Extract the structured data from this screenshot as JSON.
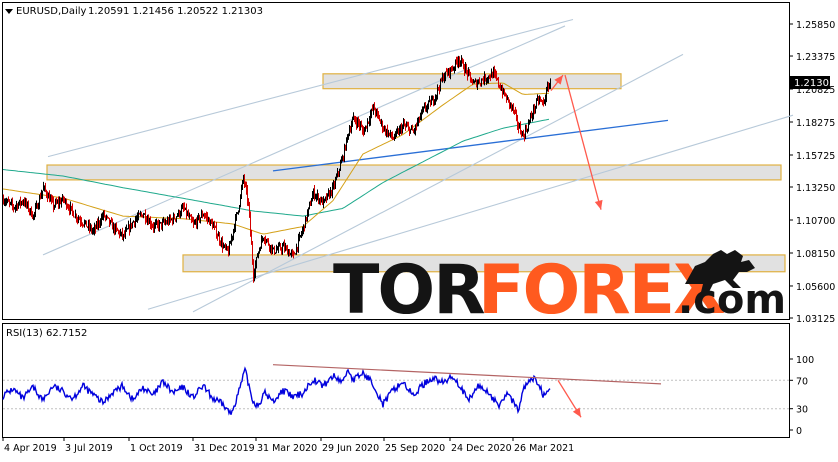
{
  "header": {
    "symbol_label": "EURUSD,Daily",
    "ohlc": "1.20591 1.21456 1.20522 1.21303"
  },
  "price_panel": {
    "current_price": "1.21303"
  },
  "rsi_panel": {
    "label": "RSI(13) 62.7152"
  },
  "watermark": {
    "part1": "TOR",
    "part2": "FOREX",
    "part3": ".com"
  },
  "colors": {
    "up_candle": "#000000",
    "down_candle": "#d40000",
    "ma_fast": "#d4a017",
    "ma_slow": "#1fa98c",
    "rsi_line": "#0000dd",
    "channel": "#b7c9d9",
    "trendline": "#2a6fd6",
    "arrow": "#ff5a4d",
    "zone_fill": "#dcdcdc",
    "zone_border": "#e0b040",
    "rsi_trendline": "#b46464",
    "watermark_dark": "#141414",
    "watermark_accent": "#ff5a1f"
  },
  "chart_data": [
    {
      "type": "candlestick",
      "series": [
        {
          "name": "EURUSD",
          "values_note": "daily OHLC"
        }
      ],
      "x": [
        "4 Apr 2019",
        "3 Jul 2019",
        "1 Oct 2019",
        "31 Dec 2019",
        "31 Mar 2020",
        "29 Jun 2020",
        "25 Sep 2020",
        "24 Dec 2020",
        "26 Mar 2021"
      ],
      "y_ticks": [
        "1.25850",
        "1.23375",
        "1.20825",
        "1.18275",
        "1.15725",
        "1.13250",
        "1.10700",
        "1.08150",
        "1.05600",
        "1.03125"
      ],
      "ylim": [
        1.03125,
        1.2585
      ],
      "close_path": [
        [
          0,
          1.123
        ],
        [
          10,
          1.117
        ],
        [
          20,
          1.122
        ],
        [
          30,
          1.11
        ],
        [
          40,
          1.132
        ],
        [
          50,
          1.118
        ],
        [
          60,
          1.123
        ],
        [
          70,
          1.112
        ],
        [
          80,
          1.105
        ],
        [
          90,
          1.098
        ],
        [
          100,
          1.111
        ],
        [
          110,
          1.101
        ],
        [
          120,
          1.094
        ],
        [
          130,
          1.106
        ],
        [
          140,
          1.112
        ],
        [
          150,
          1.102
        ],
        [
          160,
          1.104
        ],
        [
          170,
          1.108
        ],
        [
          180,
          1.116
        ],
        [
          190,
          1.103
        ],
        [
          200,
          1.112
        ],
        [
          210,
          1.102
        ],
        [
          220,
          1.086
        ],
        [
          225,
          1.082
        ],
        [
          230,
          1.1
        ],
        [
          236,
          1.12
        ],
        [
          240,
          1.14
        ],
        [
          245,
          1.119
        ],
        [
          250,
          1.065
        ],
        [
          255,
          1.083
        ],
        [
          260,
          1.095
        ],
        [
          270,
          1.083
        ],
        [
          280,
          1.086
        ],
        [
          290,
          1.079
        ],
        [
          300,
          1.101
        ],
        [
          310,
          1.128
        ],
        [
          320,
          1.12
        ],
        [
          330,
          1.132
        ],
        [
          340,
          1.157
        ],
        [
          345,
          1.175
        ],
        [
          350,
          1.185
        ],
        [
          355,
          1.182
        ],
        [
          360,
          1.175
        ],
        [
          370,
          1.194
        ],
        [
          380,
          1.178
        ],
        [
          390,
          1.17
        ],
        [
          400,
          1.18
        ],
        [
          410,
          1.175
        ],
        [
          420,
          1.192
        ],
        [
          430,
          1.2
        ],
        [
          440,
          1.218
        ],
        [
          450,
          1.225
        ],
        [
          455,
          1.232
        ],
        [
          460,
          1.226
        ],
        [
          470,
          1.212
        ],
        [
          480,
          1.216
        ],
        [
          490,
          1.22
        ],
        [
          500,
          1.205
        ],
        [
          510,
          1.192
        ],
        [
          515,
          1.179
        ],
        [
          520,
          1.172
        ],
        [
          525,
          1.181
        ],
        [
          530,
          1.192
        ],
        [
          535,
          1.2
        ],
        [
          540,
          1.197
        ],
        [
          545,
          1.211
        ],
        [
          547,
          1.213
        ]
      ],
      "ma_fast_path": [
        [
          0,
          1.131
        ],
        [
          60,
          1.124
        ],
        [
          120,
          1.11
        ],
        [
          180,
          1.108
        ],
        [
          230,
          1.104
        ],
        [
          260,
          1.096
        ],
        [
          300,
          1.102
        ],
        [
          330,
          1.122
        ],
        [
          360,
          1.158
        ],
        [
          400,
          1.173
        ],
        [
          440,
          1.196
        ],
        [
          470,
          1.212
        ],
        [
          500,
          1.213
        ],
        [
          520,
          1.204
        ],
        [
          547,
          1.205
        ]
      ],
      "ma_slow_path": [
        [
          0,
          1.146
        ],
        [
          60,
          1.141
        ],
        [
          120,
          1.132
        ],
        [
          200,
          1.121
        ],
        [
          250,
          1.114
        ],
        [
          300,
          1.11
        ],
        [
          340,
          1.116
        ],
        [
          380,
          1.136
        ],
        [
          420,
          1.152
        ],
        [
          460,
          1.168
        ],
        [
          500,
          1.178
        ],
        [
          547,
          1.185
        ]
      ],
      "zones": [
        {
          "x0": 320,
          "x1": 618,
          "y0": 1.22,
          "y1": 1.2085
        },
        {
          "x0": 44,
          "x1": 778,
          "y0": 1.1495,
          "y1": 1.138
        },
        {
          "x0": 180,
          "x1": 782,
          "y0": 1.08,
          "y1": 1.067
        }
      ],
      "trendlines": [
        {
          "role": "channel",
          "from": [
            45,
            1.156
          ],
          "to": [
            570,
            1.262
          ]
        },
        {
          "role": "channel",
          "from": [
            40,
            1.08
          ],
          "to": [
            562,
            1.257
          ]
        },
        {
          "role": "channel",
          "from": [
            190,
            1.036
          ],
          "to": [
            680,
            1.235
          ]
        },
        {
          "role": "channel",
          "from": [
            145,
            1.038
          ],
          "to": [
            790,
            1.188
          ]
        },
        {
          "role": "support",
          "from": [
            270,
            1.145
          ],
          "to": [
            665,
            1.184
          ]
        }
      ],
      "arrows": [
        {
          "from": [
            548,
            1.207
          ],
          "to": [
            560,
            1.219
          ]
        },
        {
          "from": [
            562,
            1.219
          ],
          "to": [
            598,
            1.115
          ]
        }
      ],
      "title": "",
      "xlabel": "",
      "ylabel": "",
      "grid": false,
      "legend": "none"
    },
    {
      "type": "line",
      "series": [
        {
          "name": "RSI(13)"
        }
      ],
      "y_ticks": [
        "100",
        "70",
        "30",
        "0"
      ],
      "ylim": [
        0,
        100
      ],
      "levels": [
        70,
        30
      ],
      "rsi_path": [
        [
          0,
          48
        ],
        [
          10,
          58
        ],
        [
          20,
          44
        ],
        [
          30,
          60
        ],
        [
          40,
          42
        ],
        [
          50,
          62
        ],
        [
          60,
          54
        ],
        [
          70,
          45
        ],
        [
          80,
          62
        ],
        [
          90,
          50
        ],
        [
          100,
          38
        ],
        [
          110,
          54
        ],
        [
          120,
          62
        ],
        [
          130,
          42
        ],
        [
          140,
          60
        ],
        [
          150,
          48
        ],
        [
          160,
          68
        ],
        [
          170,
          52
        ],
        [
          180,
          60
        ],
        [
          190,
          46
        ],
        [
          200,
          62
        ],
        [
          210,
          44
        ],
        [
          220,
          36
        ],
        [
          228,
          22
        ],
        [
          236,
          55
        ],
        [
          242,
          84
        ],
        [
          250,
          40
        ],
        [
          255,
          35
        ],
        [
          262,
          52
        ],
        [
          270,
          40
        ],
        [
          280,
          56
        ],
        [
          290,
          46
        ],
        [
          300,
          52
        ],
        [
          310,
          72
        ],
        [
          320,
          62
        ],
        [
          330,
          76
        ],
        [
          340,
          68
        ],
        [
          345,
          86
        ],
        [
          350,
          70
        ],
        [
          360,
          80
        ],
        [
          370,
          66
        ],
        [
          380,
          36
        ],
        [
          390,
          56
        ],
        [
          400,
          68
        ],
        [
          410,
          48
        ],
        [
          420,
          64
        ],
        [
          430,
          74
        ],
        [
          440,
          66
        ],
        [
          450,
          76
        ],
        [
          458,
          60
        ],
        [
          465,
          40
        ],
        [
          475,
          62
        ],
        [
          485,
          54
        ],
        [
          495,
          34
        ],
        [
          505,
          52
        ],
        [
          515,
          28
        ],
        [
          522,
          62
        ],
        [
          530,
          72
        ],
        [
          536,
          66
        ],
        [
          540,
          50
        ],
        [
          547,
          63
        ]
      ],
      "trendline": {
        "from": [
          270,
          92
        ],
        "to": [
          658,
          65
        ]
      },
      "arrow": {
        "from": [
          555,
          70
        ],
        "to": [
          578,
          18
        ]
      }
    }
  ]
}
